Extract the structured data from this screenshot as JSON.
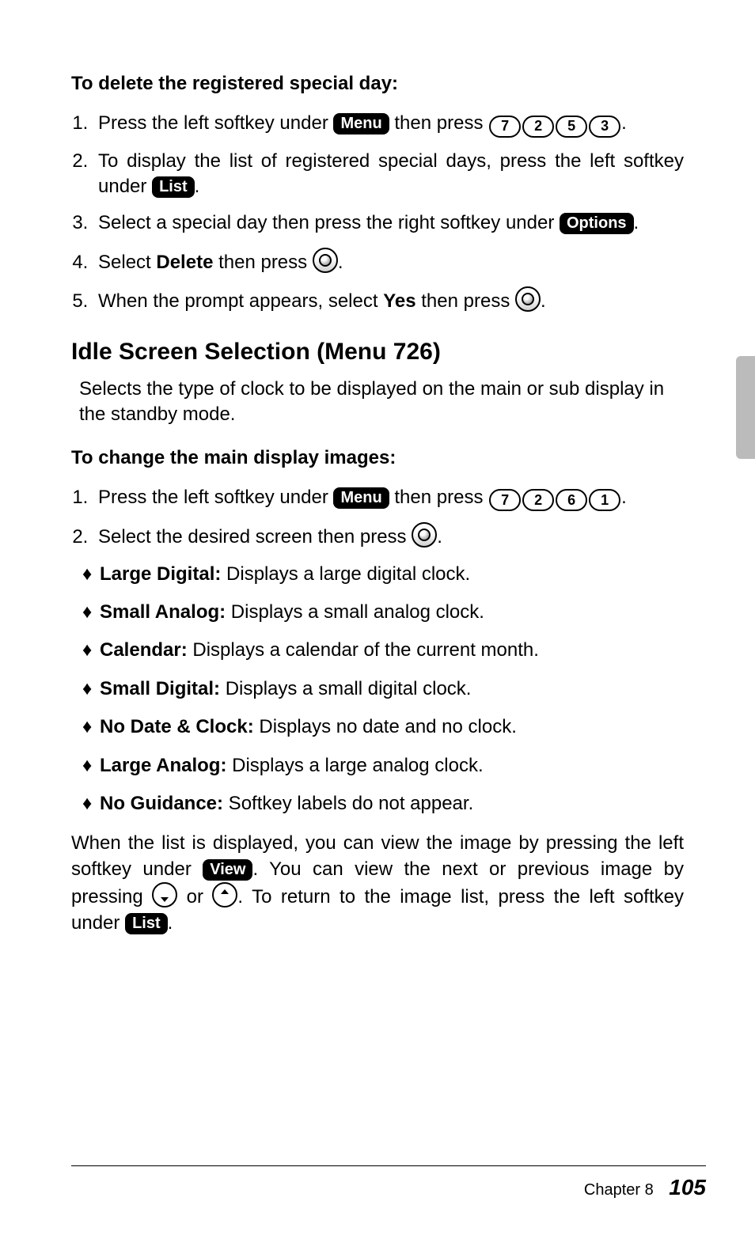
{
  "section1": {
    "heading": "To delete the registered special day:",
    "step1_a": "Press the left softkey under ",
    "step1_menu": "Menu",
    "step1_b": " then press ",
    "step1_keys": [
      "7",
      "2",
      "5",
      "3"
    ],
    "step1_c": ".",
    "step2_a": "To display the list of registered special days, press the left softkey under ",
    "step2_list": "List",
    "step2_b": ".",
    "step3_a": "Select a special day then press the right softkey under ",
    "step3_options": "Options",
    "step3_b": ".",
    "step4_a": "Select ",
    "step4_bold": "Delete",
    "step4_b": " then press ",
    "step4_c": ".",
    "step5_a": "When the prompt appears, select ",
    "step5_bold": "Yes",
    "step5_b": " then press ",
    "step5_c": "."
  },
  "section2": {
    "title": "Idle Screen Selection (Menu 726)",
    "intro": "Selects the type of clock to be displayed on the main or sub display in the standby mode.",
    "heading": "To change the main display images:",
    "step1_a": "Press the left softkey under ",
    "step1_menu": "Menu",
    "step1_b": " then press ",
    "step1_keys": [
      "7",
      "2",
      "6",
      "1"
    ],
    "step1_c": ".",
    "step2_a": "Select the desired screen then press ",
    "step2_b": ".",
    "options": [
      {
        "name": "Large Digital:",
        "desc": " Displays a large digital clock."
      },
      {
        "name": "Small Analog:",
        "desc": " Displays a small analog clock."
      },
      {
        "name": "Calendar:",
        "desc": " Displays a calendar of the current month."
      },
      {
        "name": "Small Digital:",
        "desc": " Displays a small digital clock."
      },
      {
        "name": "No Date & Clock:",
        "desc": " Displays no date and no clock."
      },
      {
        "name": "Large Analog:",
        "desc": " Displays a large analog clock."
      },
      {
        "name": "No Guidance:",
        "desc": " Softkey labels do not appear."
      }
    ],
    "after_a": "When the list is displayed, you can view the image by pressing the left softkey under ",
    "after_view": "View",
    "after_b": ". You can view the next or previous image by pressing ",
    "after_c": " or ",
    "after_d": ". To return to the image list, press the left softkey under ",
    "after_list": "List",
    "after_e": "."
  },
  "footer": {
    "chapter": "Chapter 8",
    "page": "105"
  }
}
